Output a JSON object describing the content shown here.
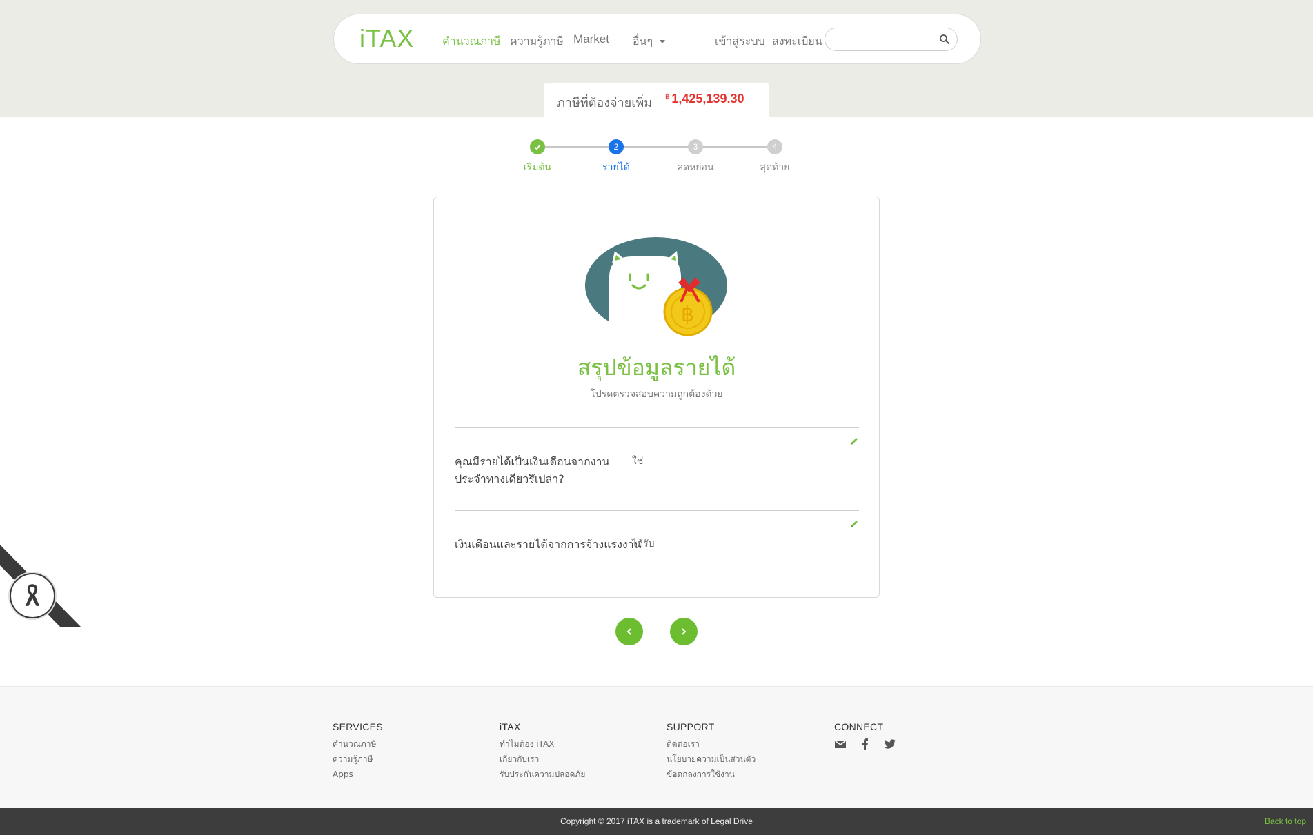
{
  "nav": {
    "logo": "iTAX",
    "calc": "คำนวณภาษี",
    "knowledge": "ความรู้ภาษี",
    "market": "Market",
    "more": "อื่นๆ",
    "login": "เข้าสู่ระบบ",
    "register": "ลงทะเบียน",
    "search_placeholder": ""
  },
  "tax_summary": {
    "label": "ภาษีที่ต้องจ่ายเพิ่ม",
    "currency": "฿",
    "amount": "1,425,139.30"
  },
  "steps": [
    {
      "number": "",
      "label": "เริ่มต้น",
      "state": "done"
    },
    {
      "number": "2",
      "label": "รายได้",
      "state": "current"
    },
    {
      "number": "3",
      "label": "ลดหย่อน",
      "state": "todo"
    },
    {
      "number": "4",
      "label": "สุดท้าย",
      "state": "todo"
    }
  ],
  "card": {
    "title": "สรุปข้อมูลรายได้",
    "subtitle": "โปรดตรวจสอบความถูกต้องด้วย",
    "rows": [
      {
        "question": "คุณมีรายได้เป็นเงินเดือนจากงานประจำทางเดียวรึเปล่า?",
        "answer": "ใช่"
      },
      {
        "question": "เงินเดือนและรายได้จากการจ้างแรงงาน",
        "answer": "ได้รับ"
      }
    ]
  },
  "footer": {
    "services": {
      "title": "SERVICES",
      "links": [
        "คำนวณภาษี",
        "ความรู้ภาษี",
        "Apps"
      ]
    },
    "itax": {
      "title": "iTAX",
      "links": [
        "ทำไมต้อง iTAX",
        "เกี่ยวกับเรา",
        "รับประกันความปลอดภัย"
      ]
    },
    "support": {
      "title": "SUPPORT",
      "links": [
        "ติดต่อเรา",
        "นโยบายความเป็นส่วนตัว",
        "ข้อตกลงการใช้งาน"
      ]
    },
    "connect": {
      "title": "CONNECT"
    },
    "copyright": "Copyright © 2017 iTAX is a trademark of Legal Drive",
    "back_to_top": "Back to top"
  },
  "colors": {
    "brand_green": "#7ac143",
    "step_blue": "#1a73e8",
    "amount_red": "#e3342f"
  }
}
